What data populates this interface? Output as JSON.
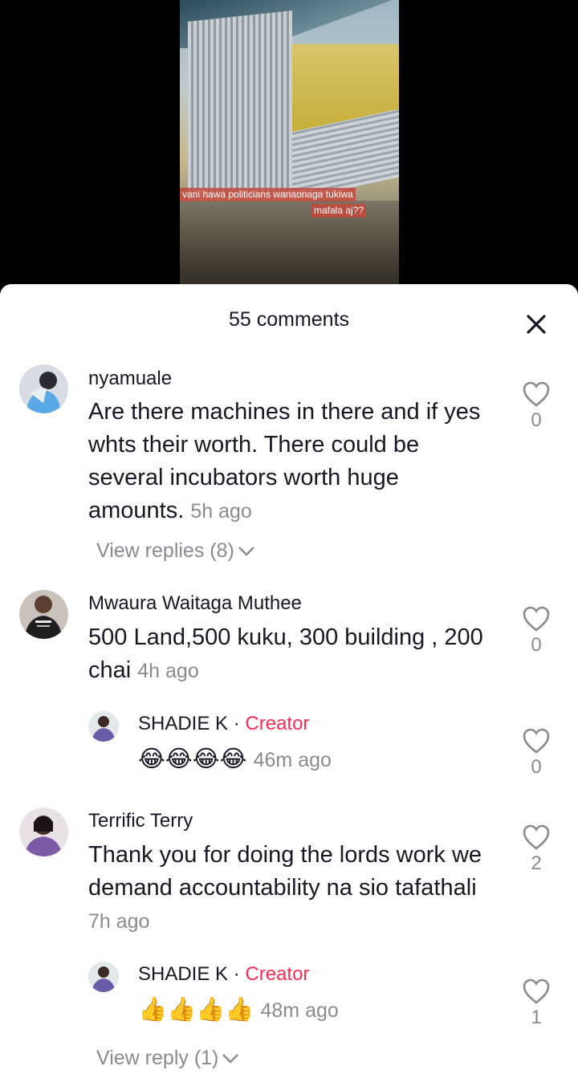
{
  "video": {
    "caption_line1": "vani hawa politicians wanaonaga tukiwa",
    "caption_line2": "mafala aj??"
  },
  "sheet": {
    "title": "55 comments",
    "close_icon": "close-icon"
  },
  "comments": [
    {
      "username": "nyamuale",
      "text": "Are there machines in there and if yes whts their worth. There could be several incubators worth huge amounts.",
      "time": "5h ago",
      "likes": "0",
      "view_replies": "View replies (8)"
    },
    {
      "username": "Mwaura Waitaga Muthee",
      "text": "500 Land,500 kuku, 300 building , 200 chai",
      "time": "4h ago",
      "likes": "0",
      "reply": {
        "username": "SHADIE K",
        "separator": "·",
        "badge": "Creator",
        "text": "😂😂😂😂",
        "time": "46m ago",
        "likes": "0"
      }
    },
    {
      "username": "Terrific Terry",
      "text": "Thank you for doing the lords work we demand accountability na sio tafathali",
      "time": "7h ago",
      "likes": "2",
      "reply": {
        "username": "SHADIE K",
        "separator": "·",
        "badge": "Creator",
        "text": "👍👍👍👍",
        "time": "48m ago",
        "likes": "1"
      },
      "view_replies": "View reply (1)"
    }
  ],
  "colors": {
    "creator": "#fe2c55",
    "muted": "#8a8b91",
    "text": "#161823"
  }
}
